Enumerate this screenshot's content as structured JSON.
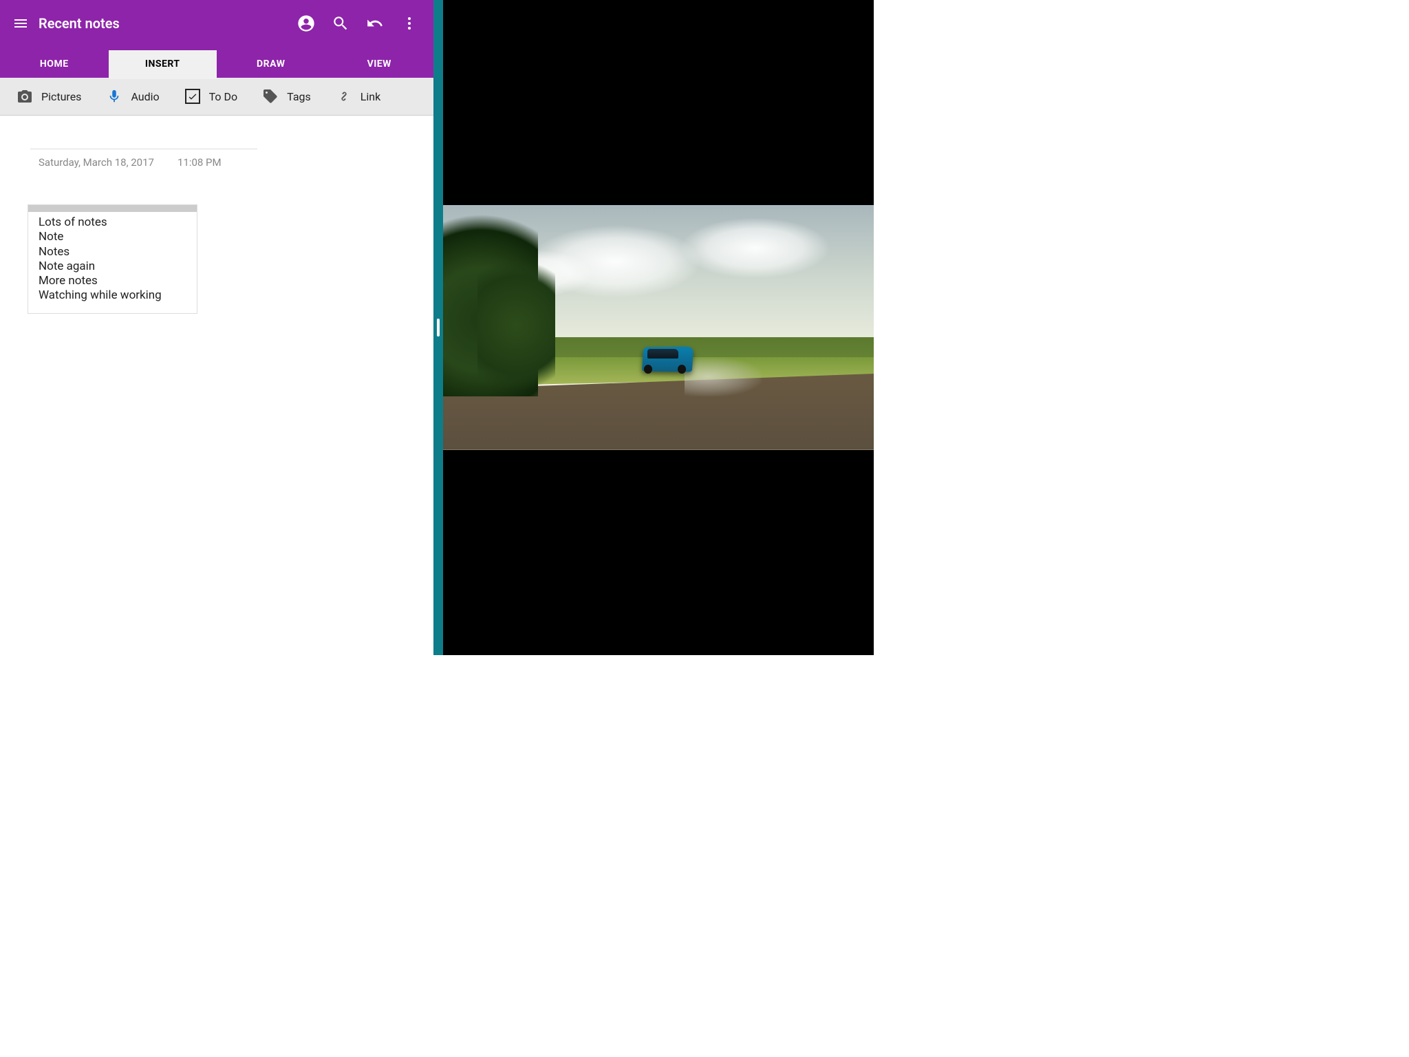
{
  "colors": {
    "primary": "#8E24AA",
    "divider": "#0e7d8a"
  },
  "appbar": {
    "title": "Recent notes"
  },
  "tabs": [
    {
      "label": "HOME",
      "active": false
    },
    {
      "label": "INSERT",
      "active": true
    },
    {
      "label": "DRAW",
      "active": false
    },
    {
      "label": "VIEW",
      "active": false
    }
  ],
  "ribbon": {
    "pictures": "Pictures",
    "audio": "Audio",
    "todo": "To Do",
    "tags": "Tags",
    "link": "Link"
  },
  "note": {
    "date": "Saturday, March 18, 2017",
    "time": "11:08 PM",
    "lines": [
      "Lots of notes",
      "Note",
      "Notes",
      "Note again",
      "More notes",
      "Watching while working"
    ]
  }
}
